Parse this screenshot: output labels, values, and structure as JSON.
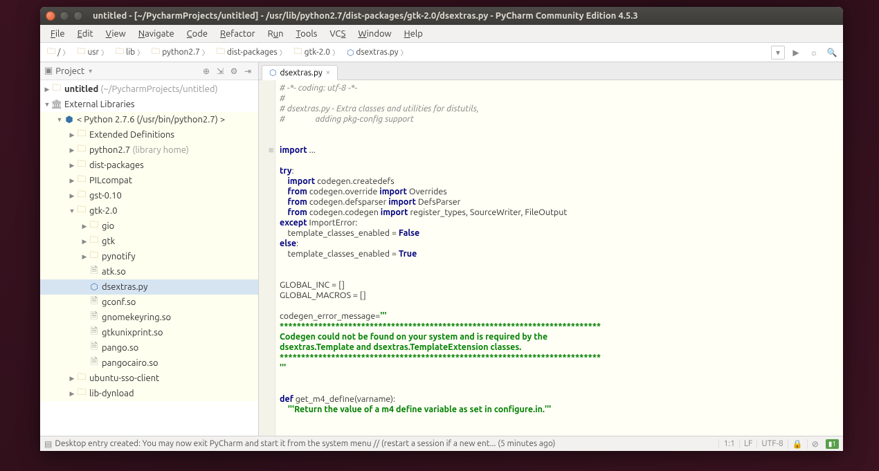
{
  "title": "untitled - [~/PycharmProjects/untitled] - /usr/lib/python2.7/dist-packages/gtk-2.0/dsextras.py - PyCharm Community Edition 4.5.3",
  "menu": [
    "File",
    "Edit",
    "View",
    "Navigate",
    "Code",
    "Refactor",
    "Run",
    "Tools",
    "VCS",
    "Window",
    "Help"
  ],
  "breadcrumbs": [
    "/",
    "usr",
    "lib",
    "python2.7",
    "dist-packages",
    "gtk-2.0",
    "dsextras.py"
  ],
  "project_panel": {
    "title": "Project",
    "tree": {
      "root": {
        "label": "untitled",
        "hint": "(~/PycharmProjects/untitled)"
      },
      "extlib": "External Libraries",
      "python": {
        "label": "< Python 2.7.6 (/usr/bin/python2.7) >"
      },
      "nodes": {
        "ext_def": "Extended Definitions",
        "py27": "python2.7",
        "py27_hint": "(library home)",
        "dist": "dist-packages",
        "pil": "PILcompat",
        "gst": "gst-0.10",
        "gtk20": "gtk-2.0",
        "gio": "gio",
        "gtk": "gtk",
        "pynotify": "pynotify",
        "atk": "atk.so",
        "dsextras": "dsextras.py",
        "gconf": "gconf.so",
        "gnomekeyring": "gnomekeyring.so",
        "gtkunixprint": "gtkunixprint.so",
        "pango": "pango.so",
        "pangocairo": "pangocairo.so",
        "ubuntu_sso": "ubuntu-sso-client",
        "lib_dynload": "lib-dynload"
      }
    }
  },
  "tab": {
    "label": "dsextras.py"
  },
  "code": {
    "cm1": "# -*- coding: utf-8 -*-",
    "cm2": "#",
    "cm3": "# dsextras.py - Extra classes and utilities for distutils,",
    "cm4": "#               adding pkg-config support",
    "imp": "import",
    "dots": " ...",
    "try": "try",
    "from": "from",
    "except": "except",
    "else": "else",
    "def": "def",
    "l_try_import": "import",
    "l_codegen_createdefs": " codegen.createdefs",
    "l_from_override": " codegen.override ",
    "l_import2": "import",
    "l_overrides": " Overrides",
    "l_from_defsparser": " codegen.defsparser ",
    "l_defsparser": " DefsParser",
    "l_from_codegen": " codegen.codegen ",
    "l_regtypes": " register_types, SourceWriter, FileOutput",
    "l_importerror": " ImportError:",
    "l_tce_false": "    template_classes_enabled = ",
    "l_false": "False",
    "l_tce_true": "    template_classes_enabled = ",
    "l_true": "True",
    "l_global_inc": "GLOBAL_INC = []",
    "l_global_macros": "GLOBAL_MACROS = []",
    "l_cem": "codegen_error_message=",
    "l_tq": "'''",
    "l_stars": "***************************************************************************",
    "l_msg1": "Codegen could not be found on your system and is required by the",
    "l_msg2": "dsextras.Template and dsextras.TemplateExtension classes.",
    "l_defname": " get_m4_define(varname):",
    "l_docstr": "    '''Return the value of a m4 define variable as set in configure.in.'''"
  },
  "status": {
    "icon_prefix": "▤",
    "msg": "Desktop entry created: You may now exit PyCharm and start it from the system menu // (restart a session if a new ent... (5 minutes ago)",
    "pos": "1:1",
    "lf": "LF",
    "enc": "UTF-8",
    "lock": "🔒",
    "git_badge": "1"
  }
}
